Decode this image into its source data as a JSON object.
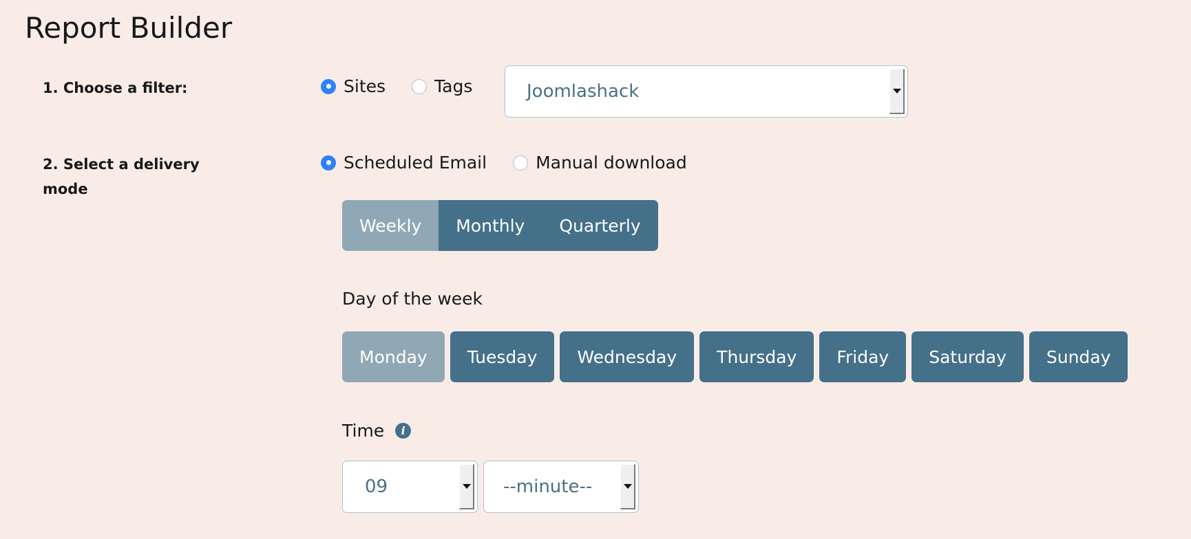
{
  "page": {
    "title": "Report Builder",
    "background_color": "#f9ece7",
    "accent_color": "#44708a",
    "accent_active_color": "#90a8b5",
    "radio_selected_color": "#2f81f7",
    "select_text_color": "#487186",
    "select_border_color": "#a9c3ce"
  },
  "filter_step": {
    "label": "1. Choose a filter:",
    "options": [
      {
        "label": "Sites",
        "selected": true
      },
      {
        "label": "Tags",
        "selected": false
      }
    ],
    "select": {
      "value": "Joomlashack",
      "icon": "chevron-down-icon"
    }
  },
  "delivery_step": {
    "label": "2. Select a delivery mode",
    "options": [
      {
        "label": "Scheduled Email",
        "selected": true
      },
      {
        "label": "Manual download",
        "selected": false
      }
    ],
    "frequency": {
      "options": [
        {
          "label": "Weekly",
          "selected": true
        },
        {
          "label": "Monthly",
          "selected": false
        },
        {
          "label": "Quarterly",
          "selected": false
        }
      ]
    },
    "day_of_week": {
      "label": "Day of the week",
      "options": [
        {
          "label": "Monday",
          "selected": true
        },
        {
          "label": "Tuesday",
          "selected": false
        },
        {
          "label": "Wednesday",
          "selected": false
        },
        {
          "label": "Thursday",
          "selected": false
        },
        {
          "label": "Friday",
          "selected": false
        },
        {
          "label": "Saturday",
          "selected": false
        },
        {
          "label": "Sunday",
          "selected": false
        }
      ]
    },
    "time": {
      "label": "Time",
      "info_icon": "info-icon",
      "hour": {
        "value": "09",
        "icon": "chevron-down-icon"
      },
      "minute": {
        "value": "--minute--",
        "icon": "chevron-down-icon"
      }
    }
  }
}
